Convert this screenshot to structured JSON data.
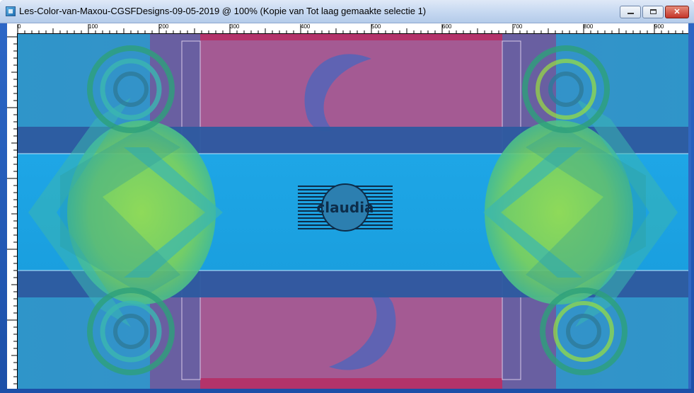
{
  "window": {
    "title": "Les-Color-van-Maxou-CGSFDesigns-09-05-2019 @ 100% (Kopie van Tot laag gemaakte selectie 1)",
    "icon": "psp-image-icon",
    "controls": [
      "minimize-icon",
      "maximize-icon",
      "close-icon"
    ]
  },
  "ruler": {
    "horizontal_labels": [
      "0",
      "100",
      "200",
      "300",
      "400",
      "500",
      "600",
      "700",
      "800",
      "900"
    ]
  },
  "canvas": {
    "watermark_text": "claudia",
    "colors": {
      "background_blue": "#2f95c9",
      "band_dark_blue": "#2d5aa0",
      "center_band": "#1aa3e3",
      "magenta": "#a45a93",
      "lime": "#8fd84a",
      "teal": "#3bb7b0"
    }
  }
}
